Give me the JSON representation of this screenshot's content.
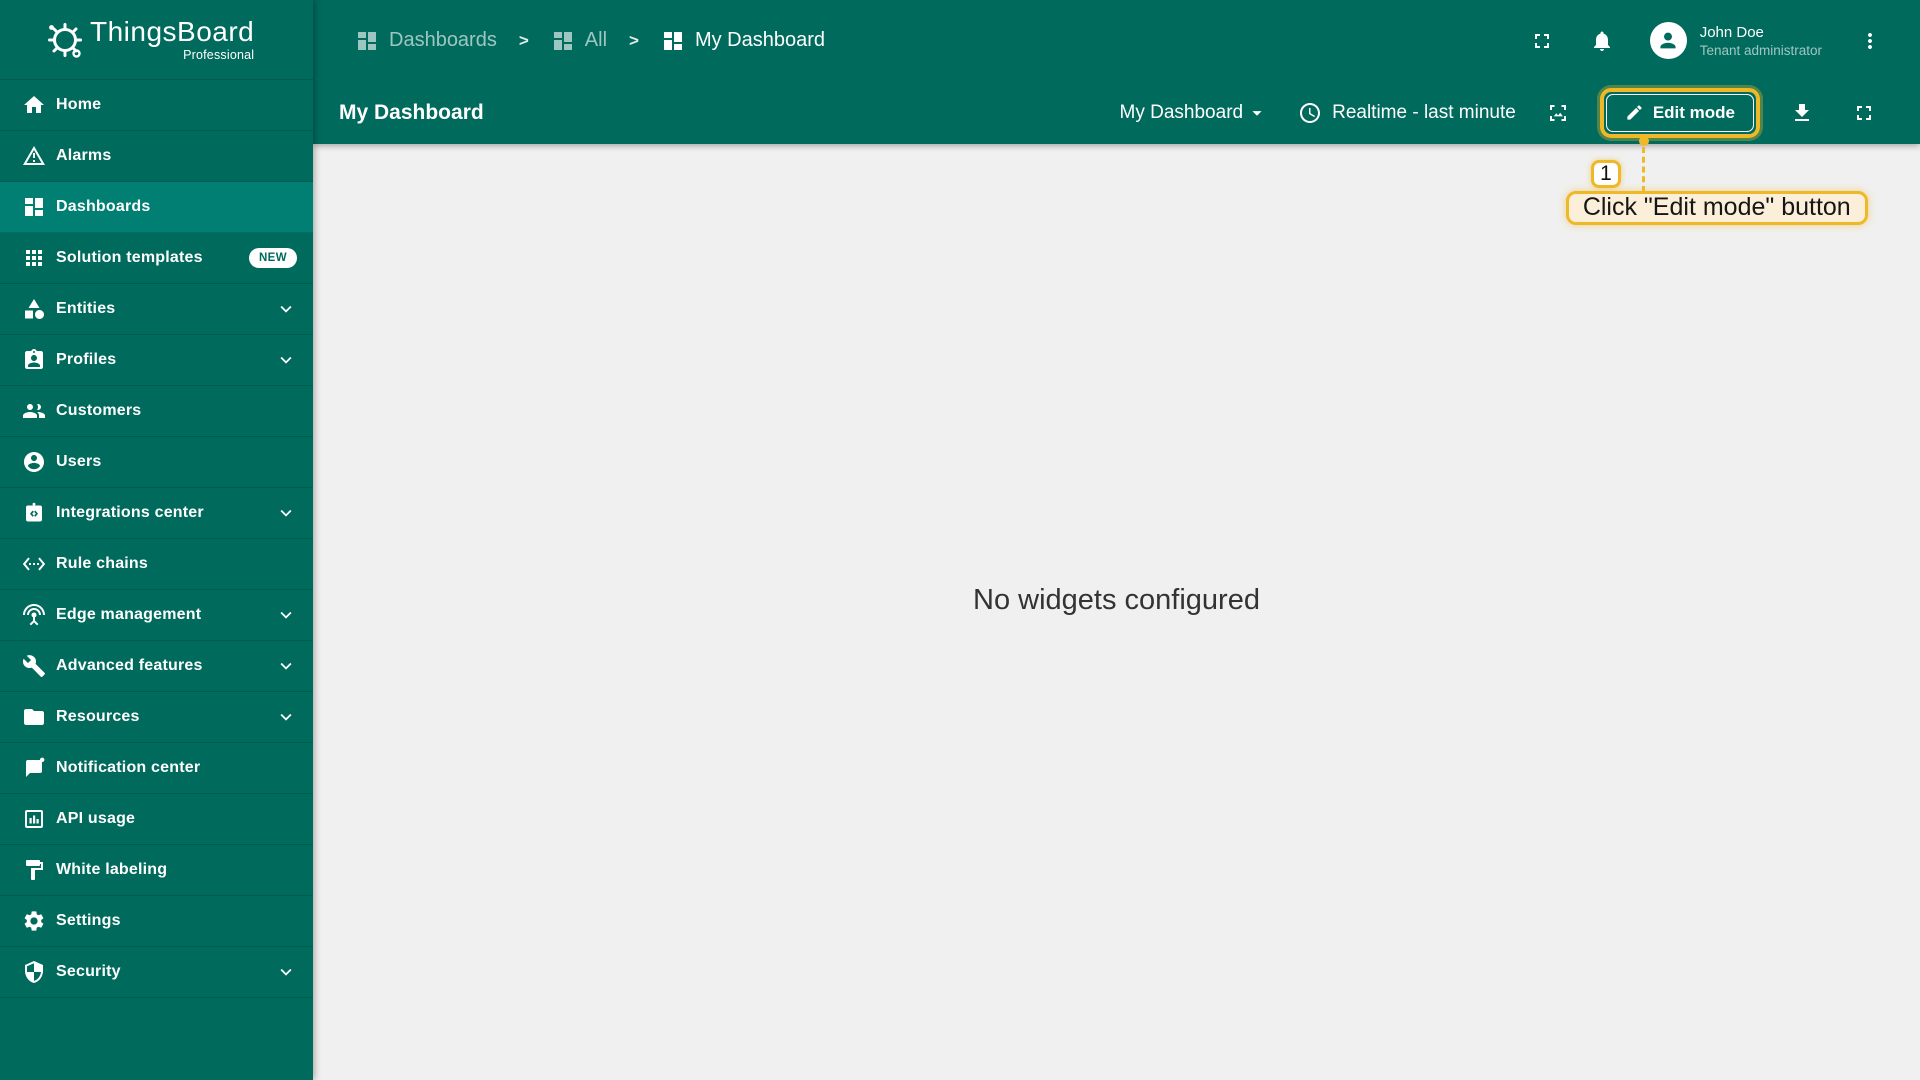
{
  "app": {
    "name": "ThingsBoard",
    "edition": "Professional",
    "logo_icon": "thingsboard-gear-logo"
  },
  "header": {
    "breadcrumb": {
      "separator": ">",
      "items": [
        {
          "label": "Dashboards",
          "icon": "dashboards-icon"
        },
        {
          "label": "All",
          "icon": "dashboards-icon"
        },
        {
          "label": "My Dashboard",
          "icon": "dashboards-icon"
        }
      ]
    },
    "actions": {
      "fullscreen_icon": "fullscreen-icon",
      "notifications_icon": "bell-icon",
      "menu_icon": "more-vert-icon"
    },
    "user": {
      "name": "John Doe",
      "role": "Tenant administrator",
      "avatar_icon": "person-icon"
    }
  },
  "sidebar": {
    "items": [
      {
        "label": "Home",
        "icon": "home-icon"
      },
      {
        "label": "Alarms",
        "icon": "alarm-warning-icon"
      },
      {
        "label": "Dashboards",
        "icon": "dashboards-icon",
        "active": true
      },
      {
        "label": "Solution templates",
        "icon": "solution-templates-grid-icon",
        "badge": "NEW"
      },
      {
        "label": "Entities",
        "icon": "entities-shapes-icon",
        "expandable": true
      },
      {
        "label": "Profiles",
        "icon": "profiles-badge-icon",
        "expandable": true
      },
      {
        "label": "Customers",
        "icon": "customers-people-icon"
      },
      {
        "label": "Users",
        "icon": "users-account-icon"
      },
      {
        "label": "Integrations center",
        "icon": "integrations-icon",
        "expandable": true
      },
      {
        "label": "Rule chains",
        "icon": "rule-chains-icon"
      },
      {
        "label": "Edge management",
        "icon": "edge-antenna-icon",
        "expandable": true
      },
      {
        "label": "Advanced features",
        "icon": "advanced-tools-icon",
        "expandable": true
      },
      {
        "label": "Resources",
        "icon": "resources-folder-icon",
        "expandable": true
      },
      {
        "label": "Notification center",
        "icon": "notification-bubble-icon"
      },
      {
        "label": "API usage",
        "icon": "api-usage-chart-icon"
      },
      {
        "label": "White labeling",
        "icon": "paint-roller-icon"
      },
      {
        "label": "Settings",
        "icon": "gear-icon"
      },
      {
        "label": "Security",
        "icon": "security-shield-icon",
        "expandable": true
      }
    ]
  },
  "toolbar": {
    "title": "My Dashboard",
    "dashboard_select": {
      "value": "My Dashboard",
      "caret_icon": "caret-down-icon"
    },
    "timewindow": {
      "label": "Realtime - last minute",
      "icon": "clock-icon"
    },
    "actions": {
      "screenshot_icon": "screenshot-icon",
      "download_icon": "download-icon",
      "fullscreen_icon": "fullscreen-icon"
    },
    "edit_button": {
      "label": "Edit mode",
      "icon": "pencil-icon"
    }
  },
  "content": {
    "empty_message": "No widgets configured"
  },
  "annotation": {
    "step": "1",
    "label": "Click \"Edit mode\" button"
  },
  "colors": {
    "primary_teal": "#006A5C",
    "active_item_teal": "#007F72",
    "content_background": "#F0F0F0",
    "annotation_gold": "#EFB829",
    "tooltip_background": "#FBEFD9",
    "badge_new_background": "#FFFFFF"
  }
}
